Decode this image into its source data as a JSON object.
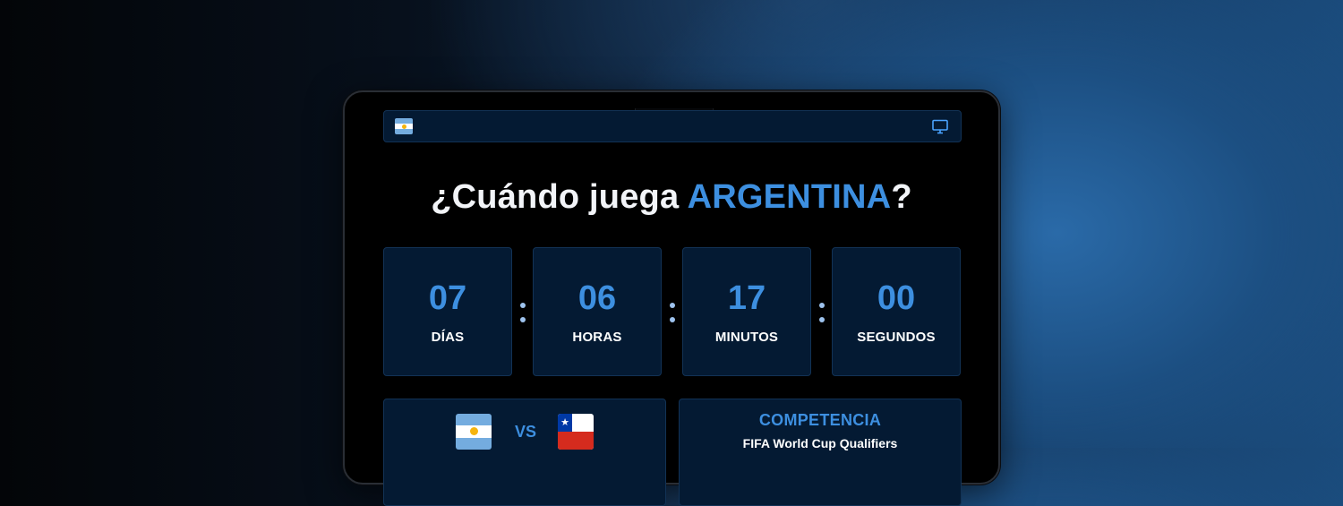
{
  "header": {
    "left_icon": "argentina-flag-icon",
    "right_icon": "monitor-icon"
  },
  "title": {
    "prefix": "¿Cuándo juega ",
    "highlight": "ARGENTINA",
    "suffix": "?"
  },
  "countdown": [
    {
      "value": "07",
      "label": "DÍAS"
    },
    {
      "value": "06",
      "label": "HORAS"
    },
    {
      "value": "17",
      "label": "MINUTOS"
    },
    {
      "value": "00",
      "label": "SEGUNDOS"
    }
  ],
  "match": {
    "home_flag": "argentina-flag-icon",
    "vs_label": "VS",
    "away_flag": "chile-flag-icon"
  },
  "competition": {
    "title": "COMPETENCIA",
    "value": "FIFA World Cup Qualifiers"
  },
  "colors": {
    "accent": "#3d8fe0",
    "panel": "#041a33",
    "panel_border": "#123255"
  }
}
